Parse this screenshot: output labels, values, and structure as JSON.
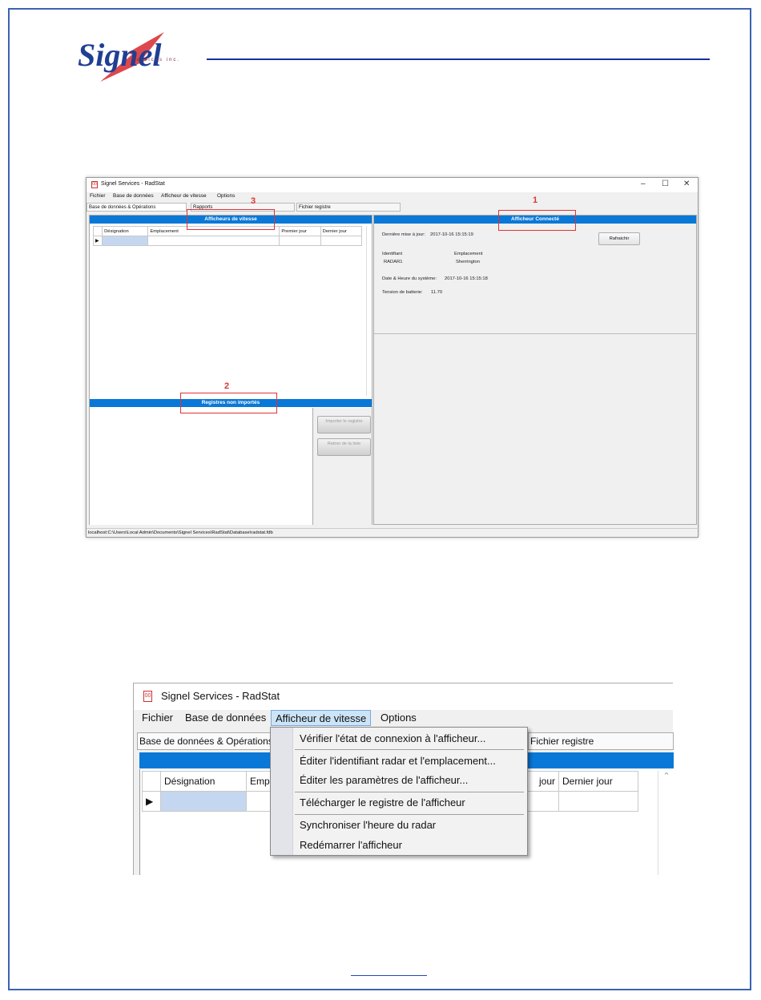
{
  "logo": {
    "wordmark": "Signel",
    "sub": "Services inc."
  },
  "window1": {
    "title": "Signel Services - RadStat",
    "window_controls": [
      "–",
      "☐",
      "✕"
    ],
    "menu": [
      "Fichier",
      "Base de données",
      "Afficheur de vitesse",
      "Options"
    ],
    "tabs": [
      "Base de données & Opérations",
      "Rapports",
      "Fichier registre"
    ],
    "left_header": "Afficheurs de vitesse",
    "grid_columns": [
      "Désignation",
      "Emplacement",
      "Premier jour",
      "Dernier jour"
    ],
    "registers_header": "Registres non importés",
    "import_button": "Importer le registre",
    "remove_button": "Retirer de la liste",
    "right_header": "Afficheur Connecté",
    "last_update_label": "Dernière mise à jour:",
    "last_update_value": "2017-10-16 15:15:19",
    "refresh_button": "Rafraichir",
    "id_label": "Identifiant",
    "id_value": "RADAR1",
    "location_label": "Emplacement",
    "location_value": "Sherrington",
    "system_time_label": "Date & Heure du système:",
    "system_time_value": "2017-10-16 15:15:18",
    "battery_label": "Tension de batterie:",
    "battery_value": "11.70",
    "status_path": "localhost:C:\\Users\\Local Admin\\Documents\\Signel Services\\RadStat\\Database\\radstat.fdb",
    "annotations": [
      "1",
      "2",
      "3"
    ]
  },
  "window2": {
    "title": "Signel Services - RadStat",
    "menu": [
      "Fichier",
      "Base de données",
      "Afficheur de vitesse",
      "Options"
    ],
    "tab_left": "Base de données & Opérations",
    "tab_right": "Fichier registre",
    "col_designation": "Désignation",
    "col_empl": "Empla",
    "col_jour": "jour",
    "col_dernier": "Dernier jour",
    "dropdown_items": [
      "Vérifier l'état de connexion à l'afficheur...",
      "Éditer l'identifiant radar et l'emplacement...",
      "Éditer les paramètres de l'afficheur...",
      "Télécharger le registre de l'afficheur",
      "Synchroniser l'heure du radar",
      "Redémarrer l'afficheur"
    ]
  },
  "colors": {
    "accent_blue": "#0a78d7",
    "annotation_red": "#e03333",
    "border_blue": "#3b63b0"
  }
}
